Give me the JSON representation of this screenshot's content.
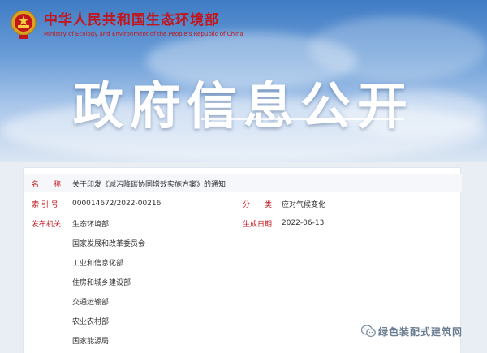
{
  "header": {
    "ministry_cn": "中华人民共和国生态环境部",
    "ministry_en": "Ministry of Ecology and Environment of the People's Republic of China"
  },
  "banner": {
    "title": "政府信息公开"
  },
  "info": {
    "name_label": "名　　称",
    "name_value": "关于印发《减污降碳协同增效实施方案》的通知",
    "index_label": "索 引 号",
    "index_value": "000014672/2022-00216",
    "category_label": "分　　类",
    "category_value": "应对气候变化",
    "issuer_label": "发布机关",
    "date_label": "生成日期",
    "date_value": "2022-06-13",
    "issuers": [
      "生态环境部",
      "国家发展和改革委员会",
      "工业和信息化部",
      "住房和城乡建设部",
      "交通运输部",
      "农业农村部",
      "国家能源局"
    ]
  },
  "watermark": {
    "text": "绿色装配式建筑网"
  },
  "colors": {
    "brand_red": "#c3151c",
    "banner_blue": "#3f7bc4"
  }
}
